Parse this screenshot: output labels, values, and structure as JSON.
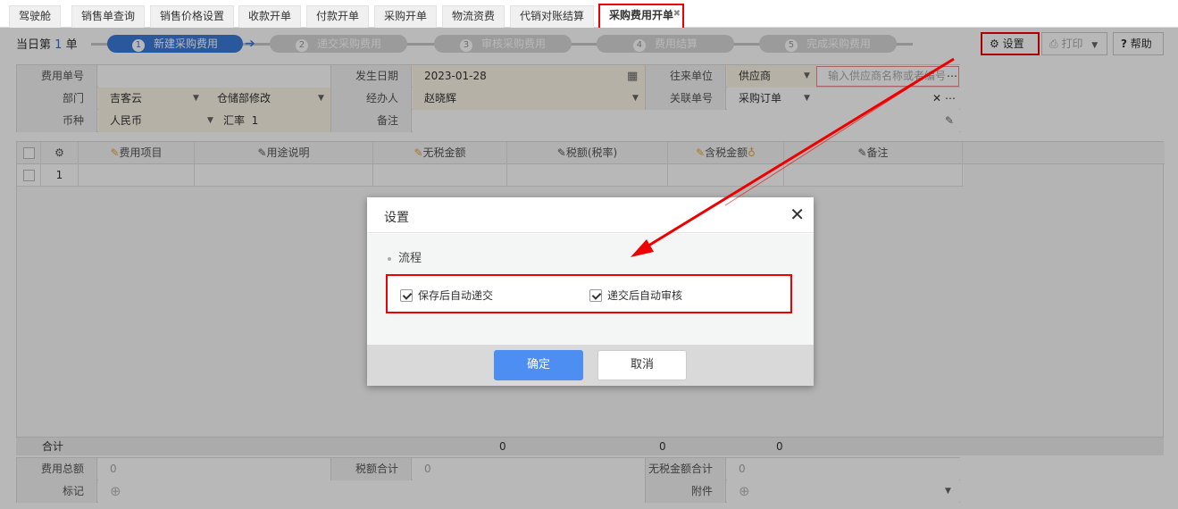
{
  "tabs": [
    {
      "label": "驾驶舱"
    },
    {
      "label": "销售单查询"
    },
    {
      "label": "销售价格设置"
    },
    {
      "label": "收款开单"
    },
    {
      "label": "付款开单"
    },
    {
      "label": "采购开单"
    },
    {
      "label": "物流资费"
    },
    {
      "label": "代销对账结算"
    },
    {
      "label": "采购费用开单",
      "active": true
    }
  ],
  "status": {
    "prefix": "当日第",
    "count": "1",
    "suffix": "单"
  },
  "steps": [
    {
      "num": "1",
      "label": "新建采购费用"
    },
    {
      "num": "2",
      "label": "递交采购费用"
    },
    {
      "num": "3",
      "label": "审核采购费用"
    },
    {
      "num": "4",
      "label": "费用结算"
    },
    {
      "num": "5",
      "label": "完成采购费用"
    }
  ],
  "toolbar": {
    "settings": "设置",
    "print": "打印",
    "help": "帮助"
  },
  "form": {
    "fee_no_label": "费用单号",
    "fee_no": "",
    "date_label": "发生日期",
    "date": "2023-01-28",
    "partner_label": "往来单位",
    "partner_type": "供应商",
    "partner_placeholder": "输入供应商名称或者编号",
    "dept_label": "部门",
    "dept": "吉客云",
    "dept_sub": "仓储部修改",
    "handler_label": "经办人",
    "handler": "赵晓辉",
    "related_label": "关联单号",
    "related": "采购订单",
    "currency_label": "币种",
    "currency": "人民币",
    "rate_label": "汇率",
    "rate": "1",
    "remark_label": "备注",
    "remark": ""
  },
  "table": {
    "columns": [
      "费用项目",
      "用途说明",
      "无税金额",
      "税额(税率)",
      "含税金额",
      "备注"
    ],
    "rows": [
      {
        "idx": "1"
      }
    ]
  },
  "summary": {
    "label": "合计",
    "v1": "0",
    "v2": "0",
    "v3": "0"
  },
  "bottom": {
    "total_label": "费用总额",
    "total": "0",
    "tax_total_label": "税额合计",
    "tax_total": "0",
    "notax_total_label": "无税金额合计",
    "notax_total": "0",
    "mark_label": "标记",
    "attach_label": "附件"
  },
  "modal": {
    "title": "设置",
    "section": "流程",
    "opt1": "保存后自动递交",
    "opt2": "递交后自动审核",
    "ok": "确定",
    "cancel": "取消"
  }
}
